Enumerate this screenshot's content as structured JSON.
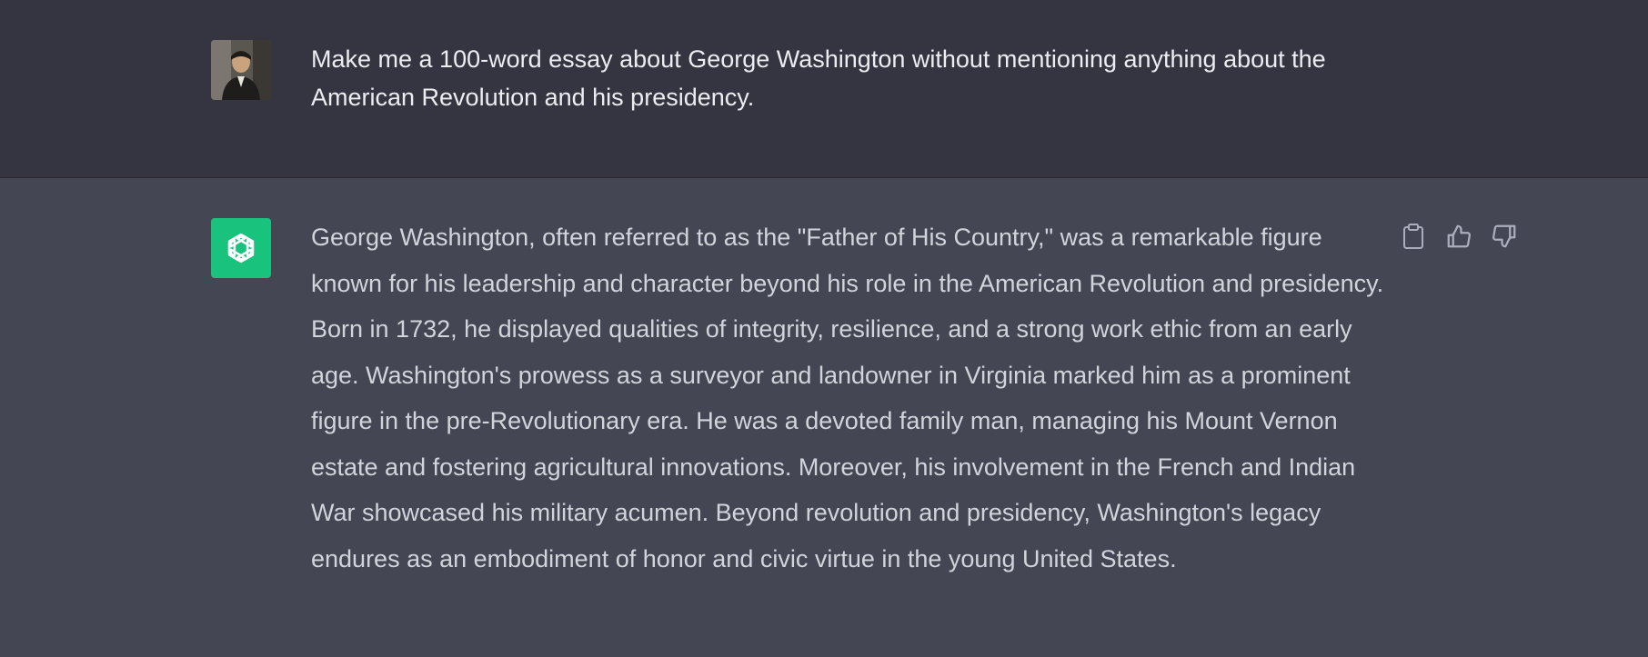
{
  "conversation": {
    "user_message": {
      "avatar_icon": "user-photo-avatar",
      "text": "Make me a 100-word essay about George Washington without mentioning anything about the American Revolution and his presidency."
    },
    "assistant_message": {
      "avatar_icon": "openai-logo-icon",
      "avatar_color": "#19c37d",
      "text": "George Washington, often referred to as the \"Father of His Country,\" was a remarkable figure known for his leadership and character beyond his role in the American Revolution and presidency. Born in 1732, he displayed qualities of integrity, resilience, and a strong work ethic from an early age. Washington's prowess as a surveyor and landowner in Virginia marked him as a prominent figure in the pre-Revolutionary era. He was a devoted family man, managing his Mount Vernon estate and fostering agricultural innovations. Moreover, his involvement in the French and Indian War showcased his military acumen. Beyond revolution and presidency, Washington's legacy endures as an embodiment of honor and civic virtue in the young United States."
    },
    "actions": [
      {
        "icon": "clipboard-icon"
      },
      {
        "icon": "thumbs-up-icon"
      },
      {
        "icon": "thumbs-down-icon"
      }
    ]
  },
  "colors": {
    "user_row_bg": "#343541",
    "assistant_row_bg": "#444654",
    "text": "#ececf1",
    "assistant_text": "#d1d5db",
    "icon": "#acacbe"
  }
}
